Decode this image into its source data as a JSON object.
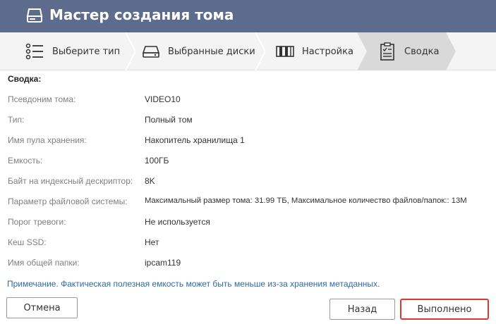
{
  "window": {
    "title": "Мастер создания тома",
    "title_icon": "storage-drive-icon"
  },
  "steps": [
    {
      "label": "Выберите тип",
      "icon": "list-icon",
      "active": false
    },
    {
      "label": "Выбранные диски",
      "icon": "disk-icon",
      "active": false
    },
    {
      "label": "Настройка",
      "icon": "settings-film-icon",
      "active": false
    },
    {
      "label": "Сводка",
      "icon": "clipboard-icon",
      "active": true
    }
  ],
  "summary": {
    "title": "Сводка:",
    "rows": [
      {
        "label": "Псевдоним тома:",
        "value": "VIDEO10"
      },
      {
        "label": "Тип:",
        "value": "Полный том"
      },
      {
        "label": "Имя пула хранения:",
        "value": "Накопитель хранилища 1"
      },
      {
        "label": "Емкость:",
        "value": "100ГБ"
      },
      {
        "label": "Байт на индексный дескриптор:",
        "value": "8K"
      },
      {
        "label": "Параметр файловой системы:",
        "value": "Максимальный размер тома: 31.99 ТБ, Максимальное количество файлов/папок:: 13M"
      },
      {
        "label": "Порог тревоги:",
        "value": "Не используется"
      },
      {
        "label": "Кеш SSD:",
        "value": "Нет"
      },
      {
        "label": "Имя общей папки:",
        "value": "ipcam119"
      }
    ]
  },
  "note": "Примечание. Фактическая полезная емкость может быть меньше из-за хранения метаданных.",
  "buttons": {
    "cancel": "Отмена",
    "back": "Назад",
    "done": "Выполнено"
  },
  "colors": {
    "titlebar": "#5d6c8c",
    "accent_border": "#d9392e",
    "note_text": "#2e6ba6"
  }
}
